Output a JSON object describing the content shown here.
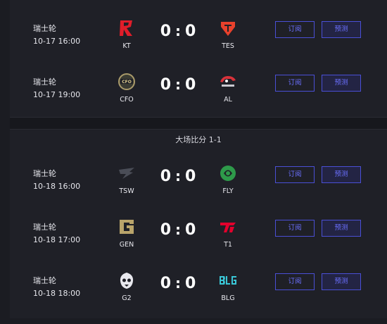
{
  "section_label": "大场比分 1-1",
  "buttons": {
    "subscribe": "订阅",
    "predict": "预测"
  },
  "matches": [
    {
      "round": "瑞士轮",
      "time": "10-17 16:00",
      "team_a": "KT",
      "team_b": "TES",
      "score_a": "0",
      "score_b": "0"
    },
    {
      "round": "瑞士轮",
      "time": "10-17 19:00",
      "team_a": "CFO",
      "team_b": "AL",
      "score_a": "0",
      "score_b": "0"
    },
    {
      "round": "瑞士轮",
      "time": "10-18 16:00",
      "team_a": "TSW",
      "team_b": "FLY",
      "score_a": "0",
      "score_b": "0"
    },
    {
      "round": "瑞士轮",
      "time": "10-18 17:00",
      "team_a": "GEN",
      "team_b": "T1",
      "score_a": "0",
      "score_b": "0"
    },
    {
      "round": "瑞士轮",
      "time": "10-18 18:00",
      "team_a": "G2",
      "team_b": "BLG",
      "score_a": "0",
      "score_b": "0"
    }
  ],
  "colors": {
    "accent": "#4a4fd6",
    "background": "#1b1c22"
  },
  "icons": [
    "kt-logo-icon",
    "tes-logo-icon",
    "cfo-logo-icon",
    "al-logo-icon",
    "tsw-logo-icon",
    "fly-logo-icon",
    "gen-logo-icon",
    "t1-logo-icon",
    "g2-logo-icon",
    "blg-logo-icon"
  ]
}
